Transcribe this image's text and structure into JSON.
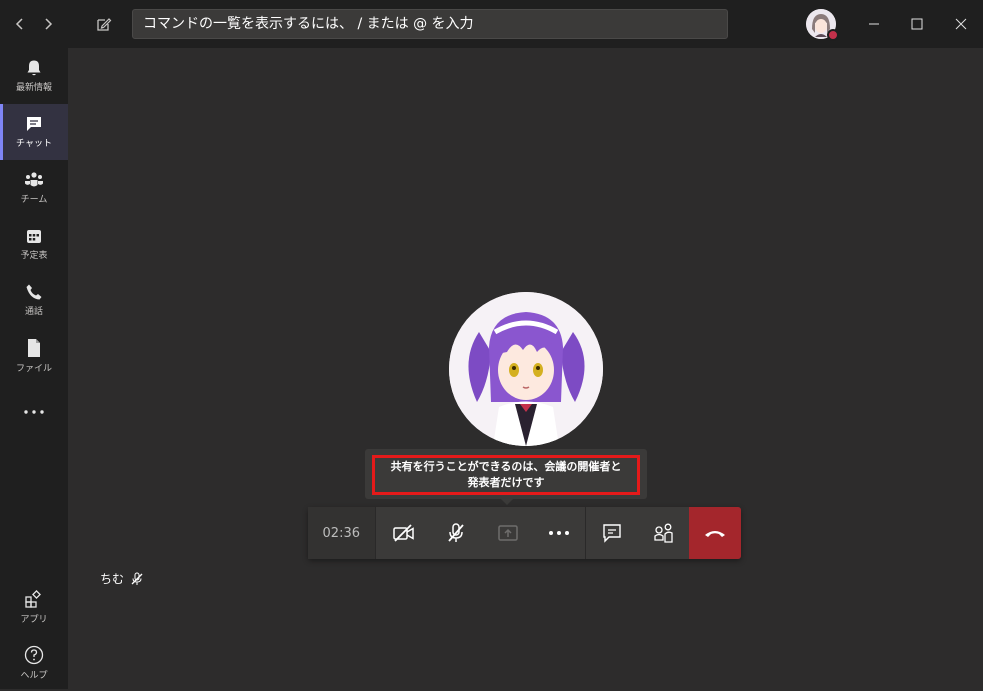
{
  "titlebar": {
    "search_placeholder": "コマンドの一覧を表示するには、 / または @ を入力",
    "back_icon": "chevron-left-icon",
    "forward_icon": "chevron-right-icon",
    "compose_icon": "compose-icon",
    "presence_color": "#c4314b"
  },
  "rail": {
    "items": [
      {
        "label": "最新情報",
        "icon": "bell-icon"
      },
      {
        "label": "チャット",
        "icon": "chat-icon",
        "active": true
      },
      {
        "label": "チーム",
        "icon": "teams-icon"
      },
      {
        "label": "予定表",
        "icon": "calendar-icon"
      },
      {
        "label": "通話",
        "icon": "phone-icon"
      },
      {
        "label": "ファイル",
        "icon": "file-icon"
      }
    ],
    "more_label": "…",
    "bottom": [
      {
        "label": "アプリ",
        "icon": "apps-icon"
      },
      {
        "label": "ヘルプ",
        "icon": "help-icon"
      }
    ]
  },
  "call": {
    "tooltip_line1": "共有を行うことができるのは、会議の開催者と",
    "tooltip_line2": "発表者だけです",
    "timer": "02:36",
    "hangup_color": "#a4262c",
    "participant_name": "ちむ"
  }
}
